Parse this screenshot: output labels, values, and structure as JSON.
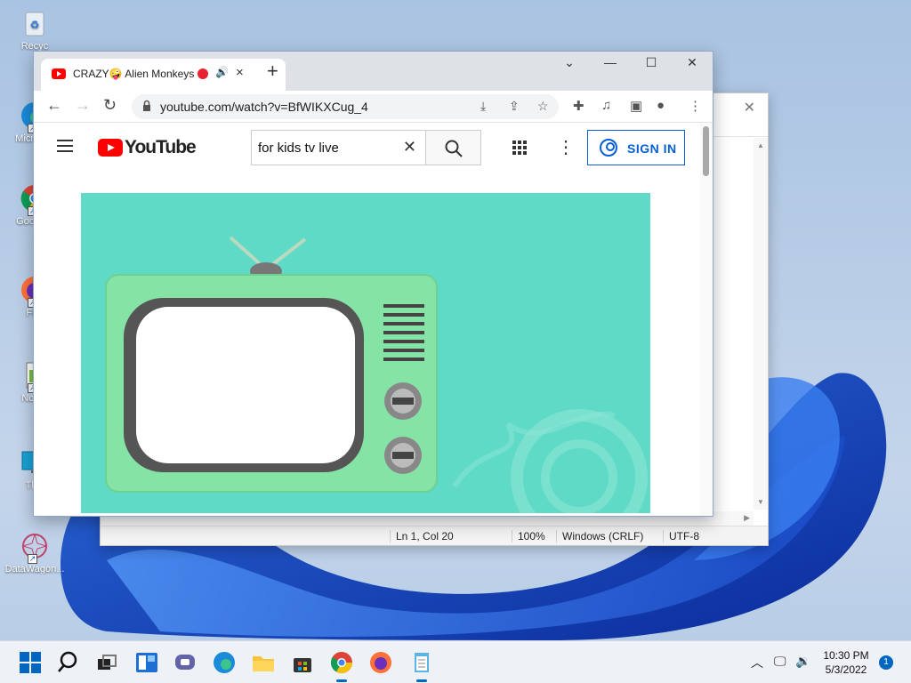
{
  "desktop": {
    "icons": [
      {
        "label": "Recyc",
        "icon": "recycle-bin-icon"
      },
      {
        "label": "Micro Ed",
        "icon": "edge-icon"
      },
      {
        "label": "Goo Chr",
        "icon": "chrome-icon"
      },
      {
        "label": "Fire",
        "icon": "firefox-icon"
      },
      {
        "label": "Notep",
        "icon": "notepad-icon"
      },
      {
        "label": "This",
        "icon": "this-pc-icon"
      },
      {
        "label": "DataWagon...",
        "icon": "datawagon-icon"
      }
    ]
  },
  "notepad": {
    "status": {
      "position": "Ln 1, Col 20",
      "zoom": "100%",
      "line_endings": "Windows (CRLF)",
      "encoding": "UTF-8"
    }
  },
  "browser": {
    "tab": {
      "title": "CRAZY🤪 Alien Monkeys",
      "favicon": "youtube-icon"
    },
    "address": "youtube.com/watch?v=BfWIKXCug_4",
    "window_controls": {
      "minimize": "—",
      "maximize": "☐",
      "close": "✕"
    }
  },
  "youtube": {
    "logo_text": "YouTube",
    "search_query": "for kids tv live",
    "signin_label": "SIGN IN"
  },
  "taskbar": {
    "clock_time": "10:30 PM",
    "clock_date": "5/3/2022",
    "notification_count": "1",
    "pinned": [
      "start",
      "search",
      "task-view",
      "widgets",
      "chat",
      "edge",
      "file-explorer",
      "store",
      "chrome",
      "firefox",
      "notepad"
    ]
  },
  "colors": {
    "accent": "#0067c0",
    "youtube_red": "#ff0000",
    "video_bg": "#5fdac6",
    "signin_blue": "#065fd4"
  }
}
